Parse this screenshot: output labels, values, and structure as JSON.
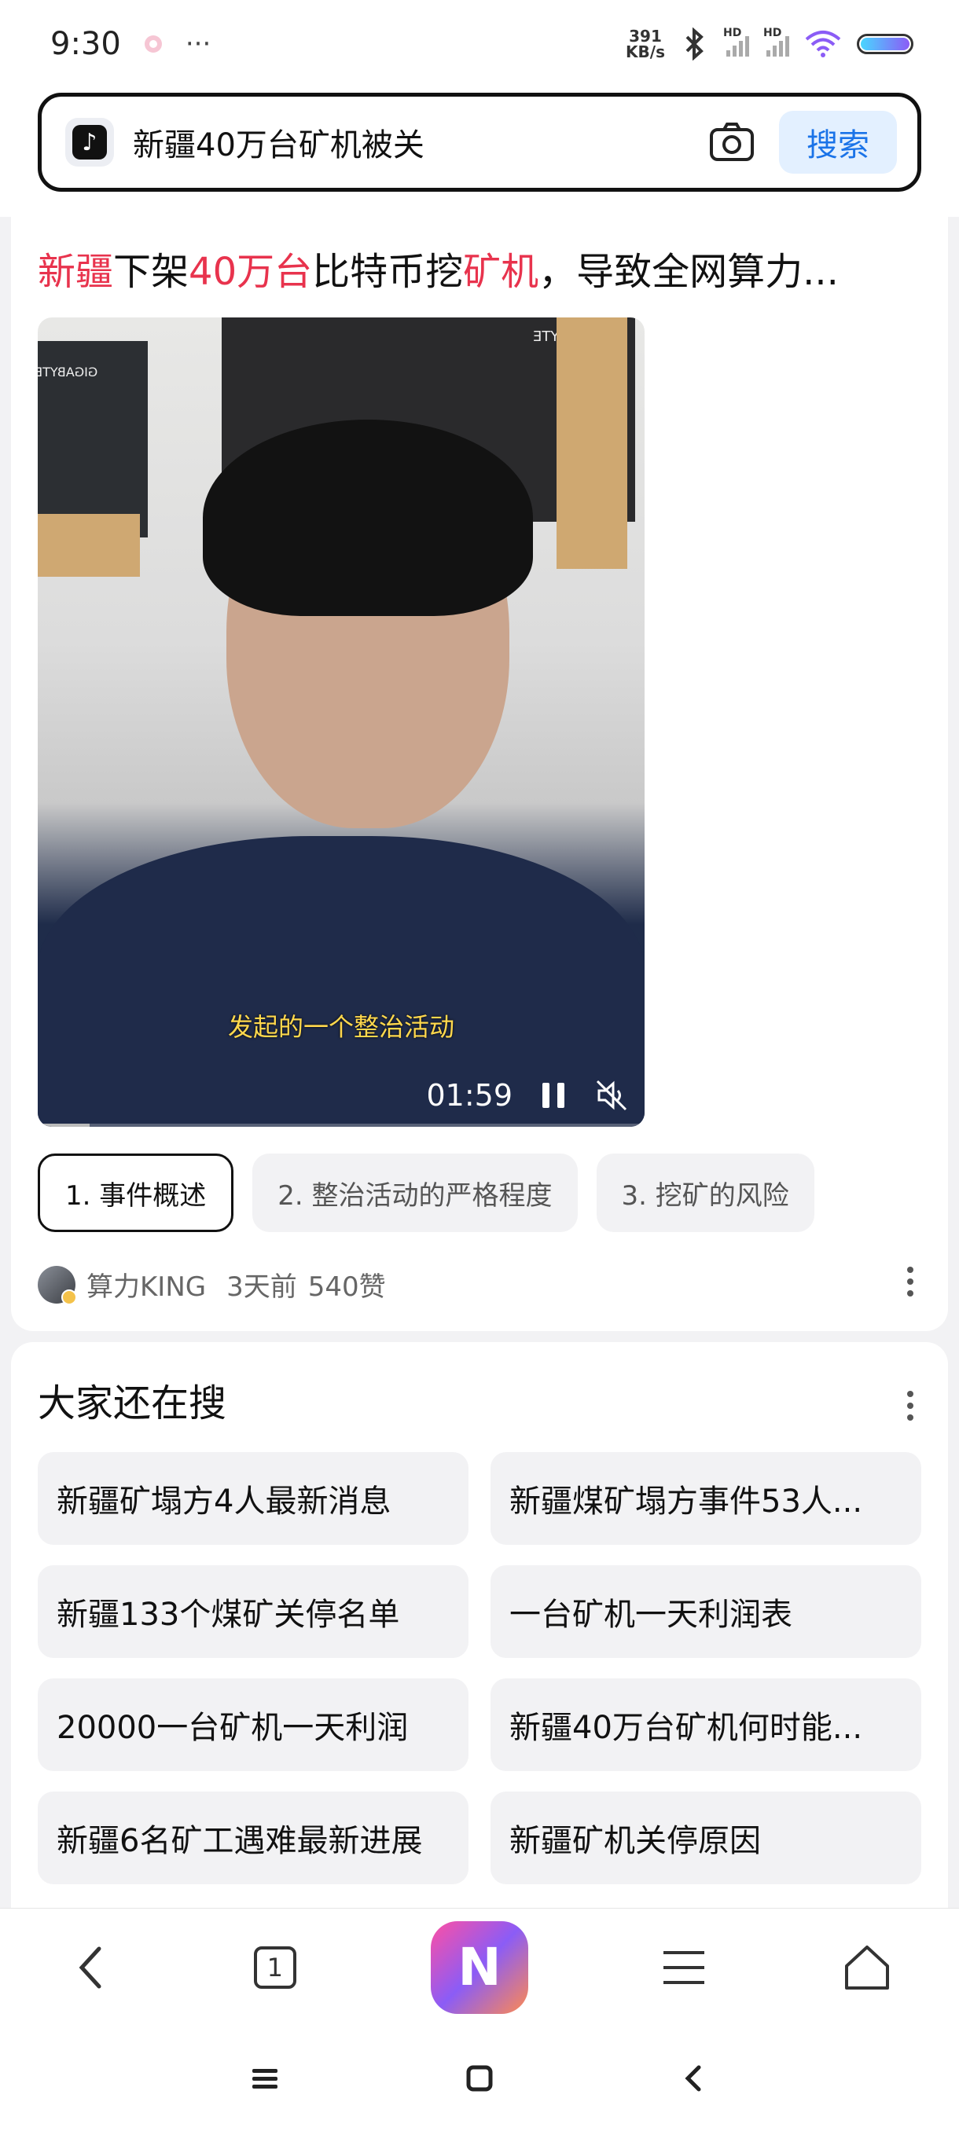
{
  "status_bar": {
    "time": "9:30",
    "more": "···",
    "net_speed_value": "391",
    "net_speed_unit": "KB/s",
    "hd1": "HD",
    "hd2": "HD"
  },
  "search": {
    "query": "新疆40万台矿机被关",
    "button_label": "搜索",
    "app_icon": "tiktok-icon"
  },
  "video": {
    "title_parts": [
      {
        "text": "新疆",
        "highlight": true
      },
      {
        "text": "下架",
        "highlight": false
      },
      {
        "text": "40万台",
        "highlight": true
      },
      {
        "text": "比特币挖",
        "highlight": false
      },
      {
        "text": "矿机",
        "highlight": true
      },
      {
        "text": "，导致全网算力...",
        "highlight": false
      }
    ],
    "subtitle": "发起的一个整治活动",
    "timestamp": "01:59",
    "progress_fraction": 0.085,
    "chapters": [
      {
        "label": "1. 事件概述",
        "active": true
      },
      {
        "label": "2. 整治活动的严格程度",
        "active": false
      },
      {
        "label": "3. 挖矿的风险",
        "active": false
      }
    ],
    "author": "算力KING",
    "posted": "3天前",
    "likes": "540赞",
    "box_text_1": "GIGABYTE",
    "box_text_2": "GIGABYTE"
  },
  "related": {
    "title": "大家还在搜",
    "items": [
      "新疆矿塌方4人最新消息",
      "新疆煤矿塌方事件53人...",
      "新疆133个煤矿关停名单",
      "一台矿机一天利润表",
      "20000一台矿机一天利润",
      "新疆40万台矿机何时能...",
      "新疆6名矿工遇难最新进展",
      "新疆矿机关停原因"
    ]
  },
  "bottom_nav": {
    "tab_count": "1",
    "center_app_letter": "N"
  },
  "colors": {
    "highlight": "#e8334d",
    "search_button_text": "#1a73e8",
    "search_button_bg": "#e3f0ff"
  }
}
